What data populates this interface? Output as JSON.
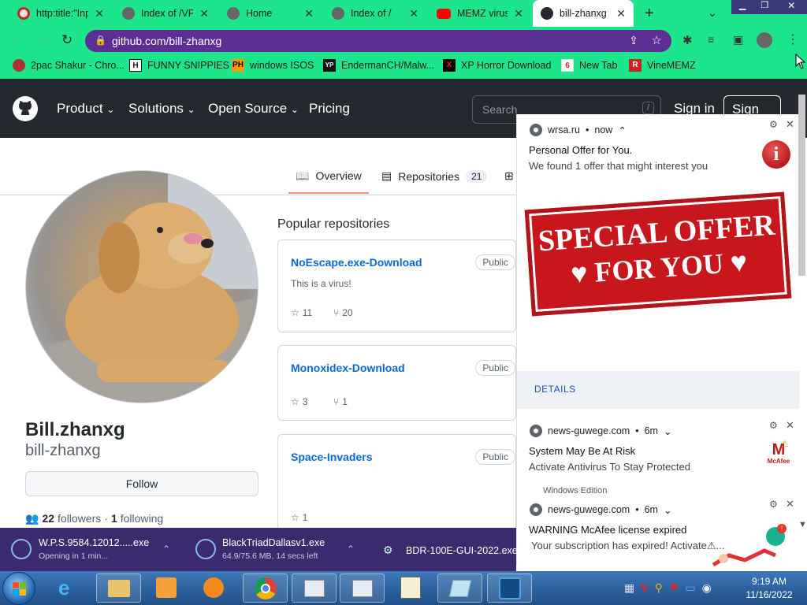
{
  "tabs": [
    {
      "title": "http:title:\"Inp",
      "active": false
    },
    {
      "title": "Index of /VPI",
      "active": false
    },
    {
      "title": "Home",
      "active": false
    },
    {
      "title": "Index of /",
      "active": false
    },
    {
      "title": "MEMZ virus",
      "active": false
    },
    {
      "title": "bill-zhanxg (",
      "active": true
    }
  ],
  "address": {
    "url": "github.com/bill-zhanxg"
  },
  "bookmarks": [
    {
      "label": "2pac Shakur - Chro...",
      "icon": "2pac-icon"
    },
    {
      "label": "FUNNY SNIPPIES",
      "icon": "H"
    },
    {
      "label": "windows ISOS",
      "icon": "PH"
    },
    {
      "label": "EndermanCH/Malw...",
      "icon": "YP"
    },
    {
      "label": "XP Horror Download",
      "icon": "X"
    },
    {
      "label": "New Tab",
      "icon": "6"
    },
    {
      "label": "VineMEMZ",
      "icon": "R"
    }
  ],
  "github": {
    "nav": [
      "Product",
      "Solutions",
      "Open Source",
      "Pricing"
    ],
    "search_placeholder": "Search",
    "search_key": "/",
    "signin": "Sign in",
    "signup": "Sign up"
  },
  "profile": {
    "display_name": "Bill.zhanxg",
    "username": "bill-zhanxg",
    "follow": "Follow",
    "followers_count": "22",
    "followers_label": "followers",
    "sep": "·",
    "following_count": "1",
    "following_label": "following"
  },
  "profile_tabs": [
    {
      "label": "Overview"
    },
    {
      "label": "Repositories",
      "count": "21"
    }
  ],
  "popular_title": "Popular repositories",
  "repos": [
    {
      "name": "NoEscape.exe-Download",
      "visibility": "Public",
      "desc": "This is a virus!",
      "stars": "11",
      "forks": "20"
    },
    {
      "name": "Monoxidex-Download",
      "visibility": "Public",
      "desc": "",
      "stars": "3",
      "forks": "1"
    },
    {
      "name": "Space-Invaders",
      "visibility": "Public",
      "desc": "",
      "stars": "1",
      "forks": ""
    }
  ],
  "notifications": [
    {
      "source": "wrsa.ru",
      "sep": "•",
      "time": "now",
      "title": "Personal Offer for You.",
      "body": "We found 1 offer that might interest you",
      "image_line1": "SPECIAL OFFER",
      "image_line2": "FOR YOU",
      "action": "DETAILS"
    },
    {
      "source": "news-guwege.com",
      "sep": "•",
      "time": "6m",
      "title": "System May Be At Risk",
      "body": "Activate Antivirus To Stay Protected",
      "peek": "Windows Edition",
      "logo": "McAfee"
    },
    {
      "source": "news-guwege.com",
      "sep": "•",
      "time": "6m",
      "title": "WARNING McAfee license expired",
      "body": "Your subscription has expired! Activate⚠..."
    }
  ],
  "downloads": [
    {
      "name": "W.P.S.9584.12012.....exe",
      "status": "Opening in 1 min..."
    },
    {
      "name": "BlackTriadDallasv1.exe",
      "status": "64.9/75.6 MB, 14 secs left"
    },
    {
      "name": "BDR-100E-GUI-2022.exe",
      "status": ""
    }
  ],
  "clock": {
    "time": "9:19 AM",
    "date": "11/16/2022"
  },
  "colors": {
    "chrome_accent": "#1de58c",
    "omnibox": "#5a2e92",
    "github_header": "#24292f",
    "link": "#0969da",
    "download_shelf": "#3b2b6e",
    "offer_red": "#c8161d"
  }
}
